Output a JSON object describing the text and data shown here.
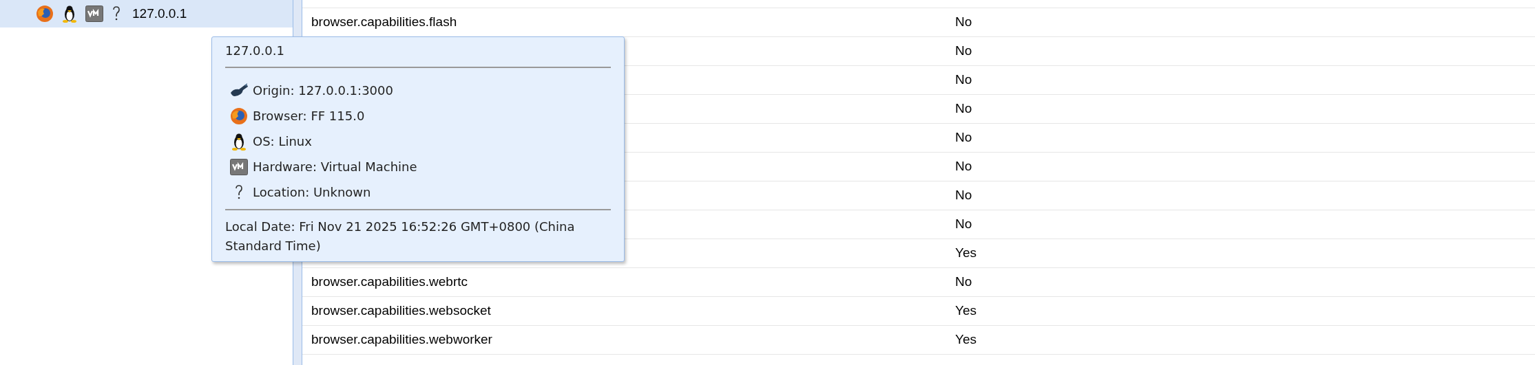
{
  "tree": {
    "host": {
      "label": "127.0.0.1",
      "selected": true
    }
  },
  "tooltip": {
    "title": "127.0.0.1",
    "details": [
      "Origin: 127.0.0.1:3000",
      "Browser: FF 115.0",
      "OS: Linux",
      "Hardware: Virtual Machine",
      "Location: Unknown"
    ],
    "local_date": "Local Date: Fri Nov 21 2025 16:52:26 GMT+0800 (China Standard Time)"
  },
  "table": {
    "rows": [
      {
        "name": "browser.capabilities.flash",
        "value": "No"
      },
      {
        "value": "No"
      },
      {
        "value": "No"
      },
      {
        "value": "No"
      },
      {
        "value": "No"
      },
      {
        "value": "No"
      },
      {
        "value": "No"
      },
      {
        "value": "No"
      },
      {
        "value": "Yes"
      },
      {
        "name": "browser.capabilities.webrtc",
        "value": "No"
      },
      {
        "name": "browser.capabilities.websocket",
        "value": "Yes"
      },
      {
        "name": "browser.capabilities.webworker",
        "value": "Yes"
      }
    ]
  }
}
